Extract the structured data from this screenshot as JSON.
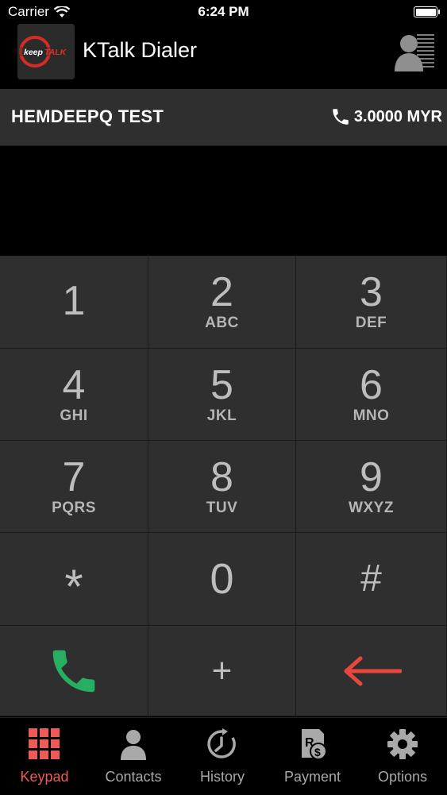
{
  "status_bar": {
    "carrier": "Carrier",
    "time": "6:24 PM"
  },
  "header": {
    "logo_text_left": "keep",
    "logo_text_right": "TALK",
    "title": "KTalk Dialer"
  },
  "account": {
    "name": "HEMDEEPQ TEST",
    "balance": "3.0000 MYR"
  },
  "display": {
    "number": ""
  },
  "keypad": {
    "keys": [
      {
        "digit": "1",
        "letters": ""
      },
      {
        "digit": "2",
        "letters": "ABC"
      },
      {
        "digit": "3",
        "letters": "DEF"
      },
      {
        "digit": "4",
        "letters": "GHI"
      },
      {
        "digit": "5",
        "letters": "JKL"
      },
      {
        "digit": "6",
        "letters": "MNO"
      },
      {
        "digit": "7",
        "letters": "PQRS"
      },
      {
        "digit": "8",
        "letters": "TUV"
      },
      {
        "digit": "9",
        "letters": "WXYZ"
      },
      {
        "digit": "*",
        "letters": ""
      },
      {
        "digit": "0",
        "letters": ""
      },
      {
        "digit": "#",
        "letters": ""
      }
    ],
    "plus": "+",
    "call_color": "#27ae60",
    "backspace_color": "#e8473f"
  },
  "tabs": [
    {
      "label": "Keypad",
      "icon": "keypad-icon"
    },
    {
      "label": "Contacts",
      "icon": "contacts-icon"
    },
    {
      "label": "History",
      "icon": "history-icon"
    },
    {
      "label": "Payment",
      "icon": "payment-icon"
    },
    {
      "label": "Options",
      "icon": "gear-icon"
    }
  ],
  "colors": {
    "active_tab": "#ee5a57",
    "key_bg": "#2f2f2f",
    "accent_red": "#e0302b"
  }
}
